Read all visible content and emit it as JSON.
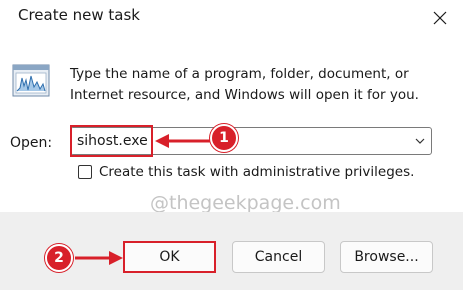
{
  "window": {
    "title": "Create new task",
    "close_icon": "close-icon"
  },
  "dialog": {
    "description": "Type the name of a program, folder, document, or Internet resource, and Windows will open it for you.",
    "open_label": "Open:",
    "open_value": "sihost.exe",
    "admin_checkbox_label": "Create this task with administrative privileges.",
    "admin_checked": false
  },
  "buttons": {
    "ok": "OK",
    "cancel": "Cancel",
    "browse": "Browse..."
  },
  "annotations": {
    "step1": "1",
    "step2": "2",
    "color": "#d8202a"
  },
  "watermark": "@thegeekpage.com"
}
